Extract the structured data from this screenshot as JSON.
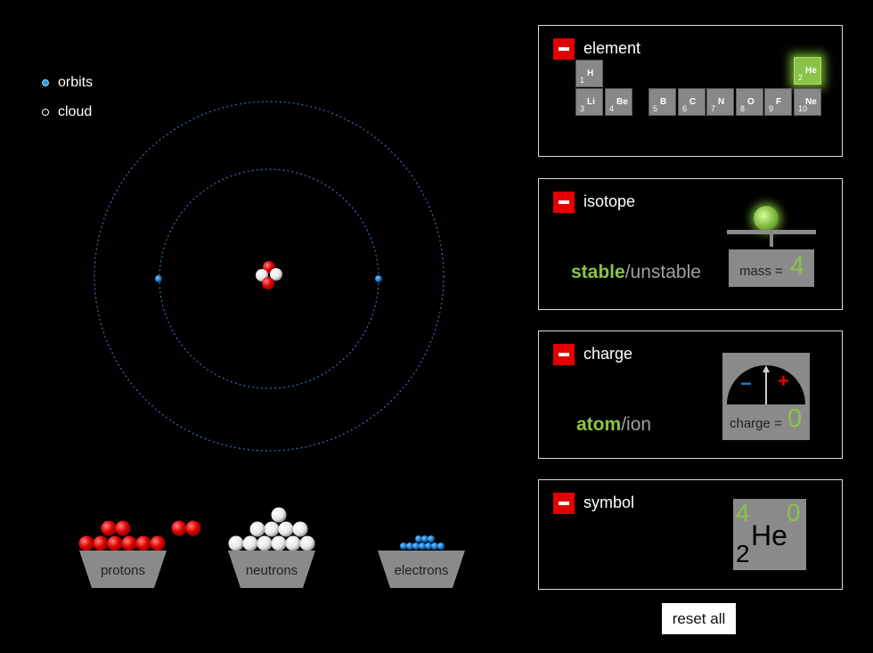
{
  "view_options": {
    "orbits_label": "orbits",
    "cloud_label": "cloud",
    "selected": "orbits"
  },
  "buckets": {
    "protons_label": "protons",
    "neutrons_label": "neutrons",
    "electrons_label": "electrons"
  },
  "panels": {
    "element": {
      "title": "element",
      "selected": "He",
      "elements": [
        {
          "num": "1",
          "sym": "H"
        },
        {
          "num": "2",
          "sym": "He"
        },
        {
          "num": "3",
          "sym": "Li"
        },
        {
          "num": "4",
          "sym": "Be"
        },
        {
          "num": "5",
          "sym": "B"
        },
        {
          "num": "6",
          "sym": "C"
        },
        {
          "num": "7",
          "sym": "N"
        },
        {
          "num": "8",
          "sym": "O"
        },
        {
          "num": "9",
          "sym": "F"
        },
        {
          "num": "10",
          "sym": "Ne"
        }
      ]
    },
    "isotope": {
      "title": "isotope",
      "stable": "stable",
      "slash": "/",
      "unstable": "unstable",
      "mass_label": "mass =",
      "mass_value": "4"
    },
    "charge": {
      "title": "charge",
      "atom": "atom",
      "slash": "/",
      "ion": "ion",
      "minus_sign": "−",
      "plus_sign": "+",
      "charge_label": "charge =",
      "charge_value": "0"
    },
    "symbol": {
      "title": "symbol",
      "mass_number": "4",
      "atomic_number": "2",
      "element_symbol": "He",
      "charge": "0"
    }
  },
  "reset_label": "reset all",
  "colors": {
    "accent_green": "#8bc34a",
    "minus_red": "#e30000",
    "proton_red": "#e00000",
    "electron_blue": "#1e7fd0",
    "panel_gray": "#888888"
  }
}
